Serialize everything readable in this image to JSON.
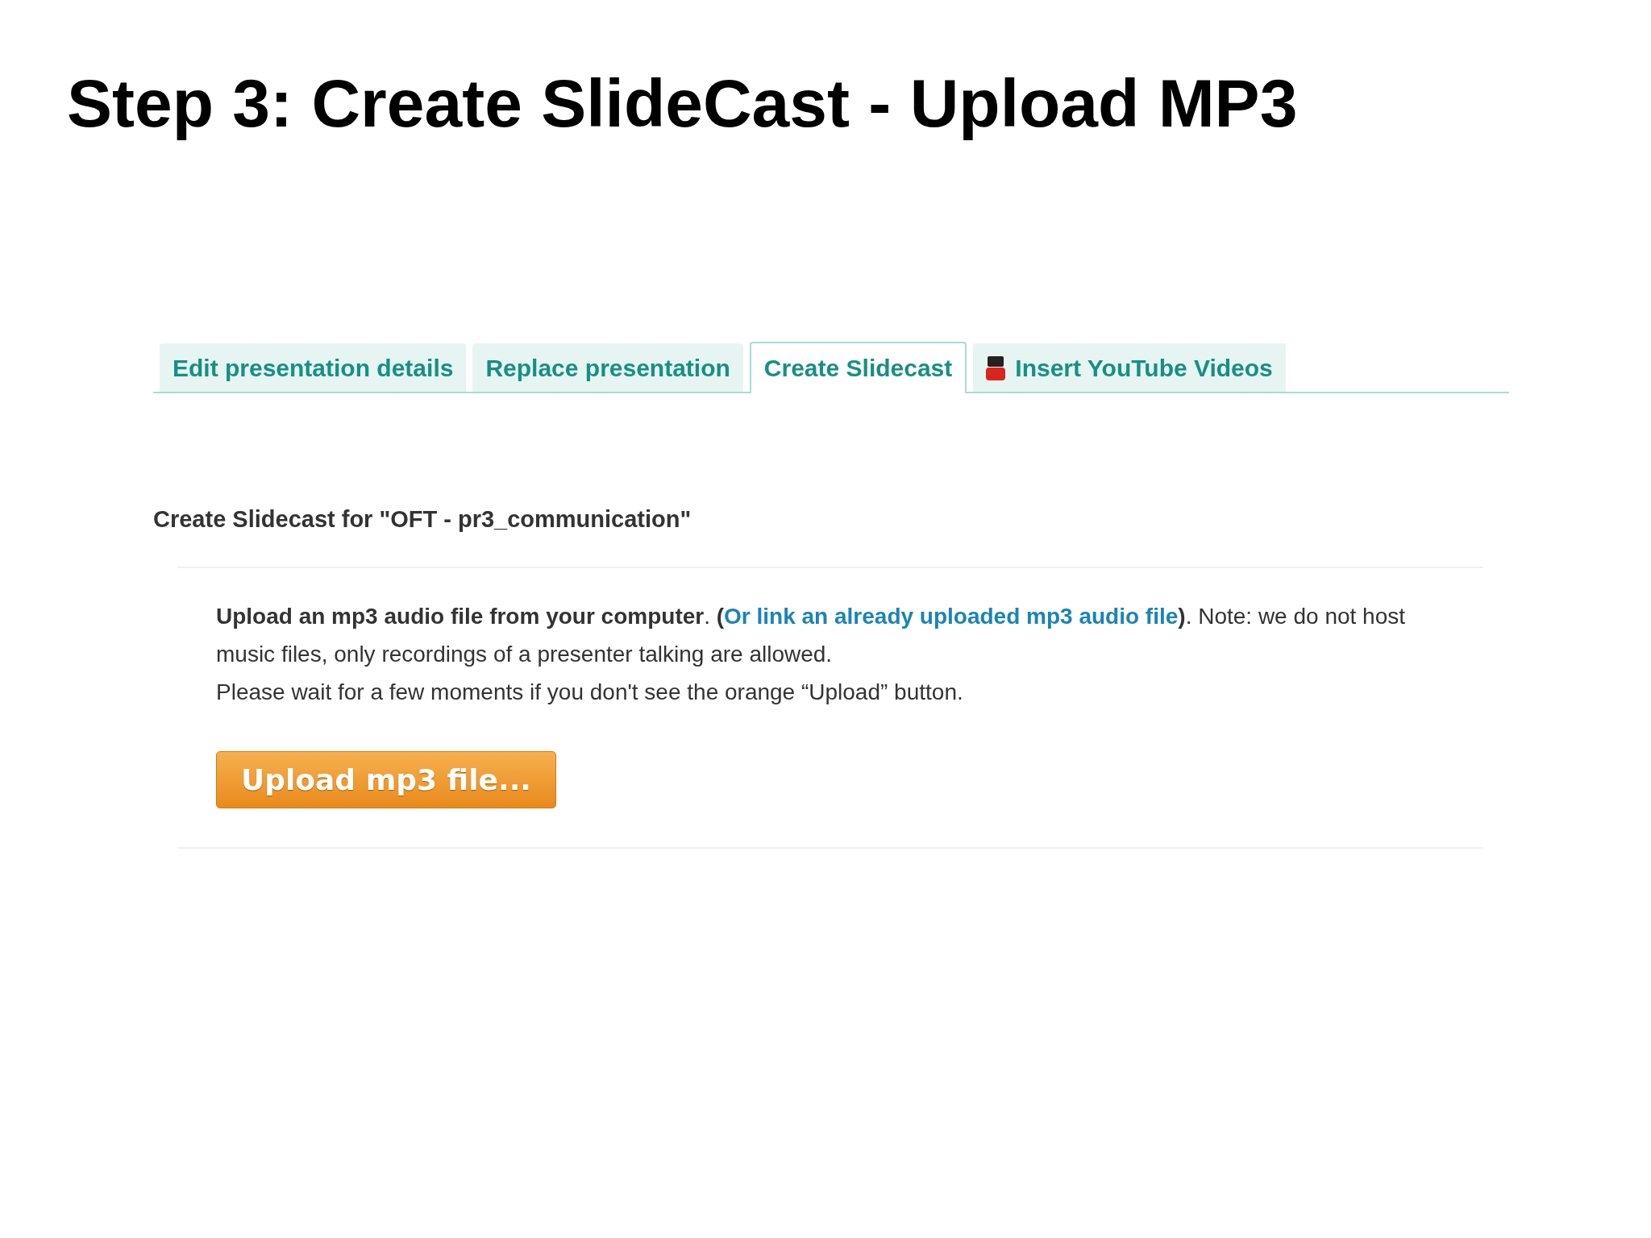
{
  "title": "Step 3: Create SlideCast - Upload MP3",
  "tabs": [
    {
      "label": "Edit presentation details",
      "selected": false,
      "kind": "text"
    },
    {
      "label": "Replace presentation",
      "selected": false,
      "kind": "text"
    },
    {
      "label": "Create Slidecast",
      "selected": true,
      "kind": "text"
    },
    {
      "label": "Insert YouTube Videos",
      "selected": false,
      "kind": "video"
    }
  ],
  "heading": "Create Slidecast for \"OFT - pr3_communication\"",
  "notice": {
    "before": "**Upload an mp3 audio file from your computer**. **(**",
    "link": "Or link an already uploaded mp3 audio file",
    "after": "**)**. Note: we do not host music files, only recordings of a presenter talking are allowed."
  },
  "wait_note": "Please wait for a few moments if you don't see the orange “Upload” button.",
  "upload_button": "Upload mp3 file..."
}
